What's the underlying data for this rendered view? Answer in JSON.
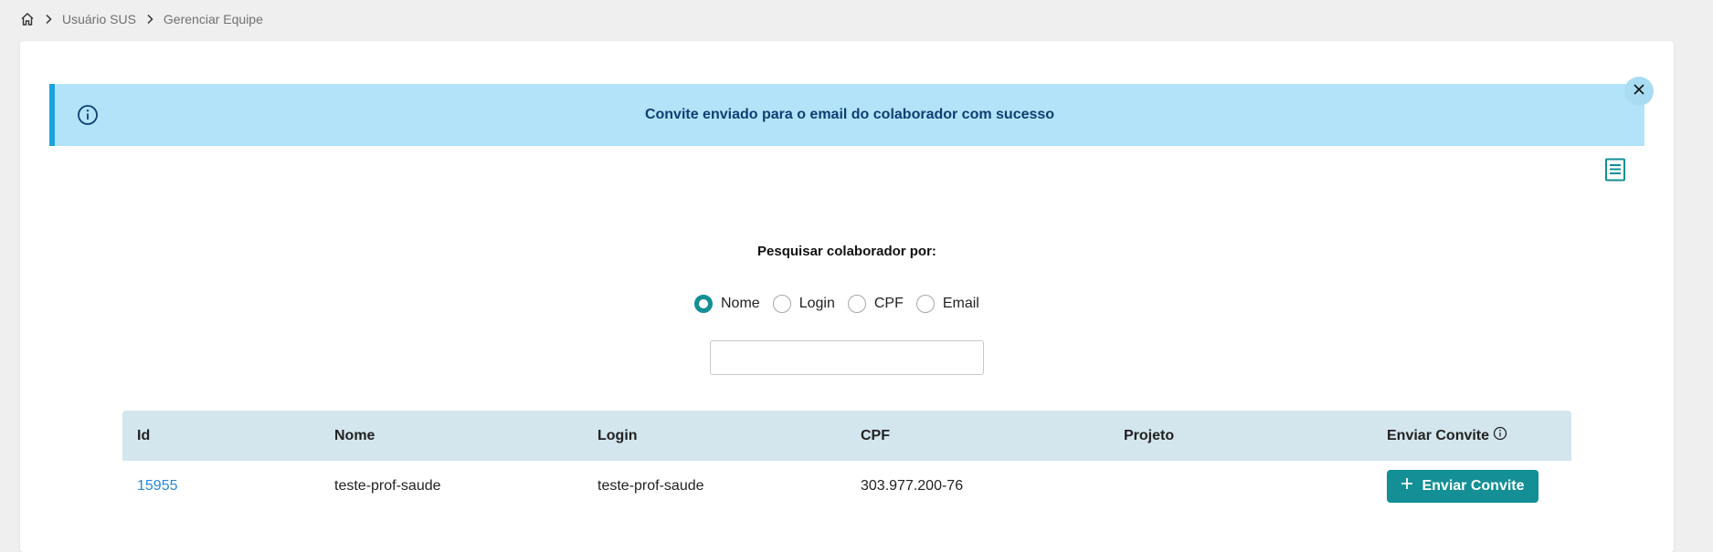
{
  "breadcrumb": {
    "items": [
      "Usuário SUS",
      "Gerenciar Equipe"
    ]
  },
  "alert": {
    "message": "Convite enviado para o email do colaborador com sucesso",
    "icon": "info-icon",
    "close_icon": "close-icon"
  },
  "toolbar": {
    "doc_icon": "document-icon"
  },
  "search": {
    "label": "Pesquisar colaborador por:",
    "options": [
      "Nome",
      "Login",
      "CPF",
      "Email"
    ],
    "selected": "Nome",
    "value": "",
    "placeholder": ""
  },
  "table": {
    "headers": [
      "Id",
      "Nome",
      "Login",
      "CPF",
      "Projeto",
      "Enviar Convite"
    ],
    "rows": [
      {
        "id": "15955",
        "nome": "teste-prof-saude",
        "login": "teste-prof-saude",
        "cpf": "303.977.200-76",
        "projeto": "",
        "action_label": "Enviar Convite"
      }
    ]
  },
  "colors": {
    "accent": "#138f95",
    "alert_bg": "#b3e3f9",
    "alert_border": "#1da1e0",
    "table_header_bg": "#d3e6ee",
    "link": "#2a86d6"
  }
}
